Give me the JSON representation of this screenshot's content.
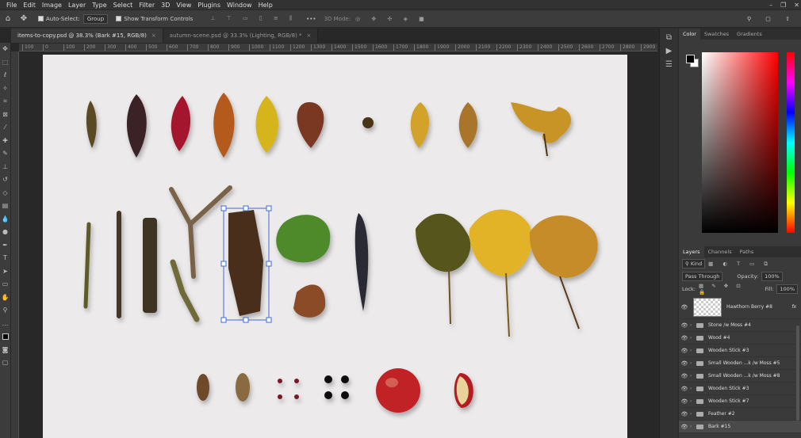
{
  "menu": [
    "File",
    "Edit",
    "Image",
    "Layer",
    "Type",
    "Select",
    "Filter",
    "3D",
    "View",
    "Plugins",
    "Window",
    "Help"
  ],
  "window_controls": [
    "–",
    "❐",
    "✕"
  ],
  "options": {
    "auto_select_label": "Auto-Select:",
    "auto_select_value": "Group",
    "show_transform_label": "Show Transform Controls",
    "mode_3d": "3D Mode:"
  },
  "tabs": [
    {
      "label": "items-to-copy.psd @ 38.3% (Bark #15, RGB/8)",
      "close": "×"
    },
    {
      "label": "autumn-scene.psd @ 33.3% (Lighting, RGB/8) *",
      "close": "×"
    }
  ],
  "ruler_ticks": [
    "100",
    "0",
    "100",
    "200",
    "300",
    "400",
    "500",
    "600",
    "700",
    "800",
    "900",
    "1000",
    "1100",
    "1200",
    "1300",
    "1400",
    "1500",
    "1600",
    "1700",
    "1800",
    "1900",
    "2000",
    "2100",
    "2200",
    "2300",
    "2400",
    "2500",
    "2600",
    "2700",
    "2800",
    "2900"
  ],
  "color_panel": {
    "tabs": [
      "Color",
      "Swatches",
      "Gradients"
    ],
    "fg": "#000000",
    "bg": "#ffffff"
  },
  "layers_panel": {
    "tabs": [
      "Layers",
      "Channels",
      "Paths"
    ],
    "kind": "Kind",
    "blend": "Pass Through",
    "opacity_label": "Opacity:",
    "opacity": "100%",
    "lock_label": "Lock:",
    "fill_label": "Fill:",
    "fill": "100%",
    "layers": [
      {
        "name": "Hawthorn Berry #8",
        "type": "layer",
        "fx": "fx"
      },
      {
        "name": "Stone /w Moss #4",
        "type": "group"
      },
      {
        "name": "Wood #4",
        "type": "group"
      },
      {
        "name": "Wooden Stick #3",
        "type": "group"
      },
      {
        "name": "Small Wooden ...k /w Moss #5",
        "type": "group"
      },
      {
        "name": "Small Wooden ...k /w Moss #8",
        "type": "group"
      },
      {
        "name": "Wooden Stick #3",
        "type": "group"
      },
      {
        "name": "Wooden Stick #7",
        "type": "group"
      },
      {
        "name": "Feather #2",
        "type": "group"
      },
      {
        "name": "Bark #15",
        "type": "group"
      }
    ]
  }
}
